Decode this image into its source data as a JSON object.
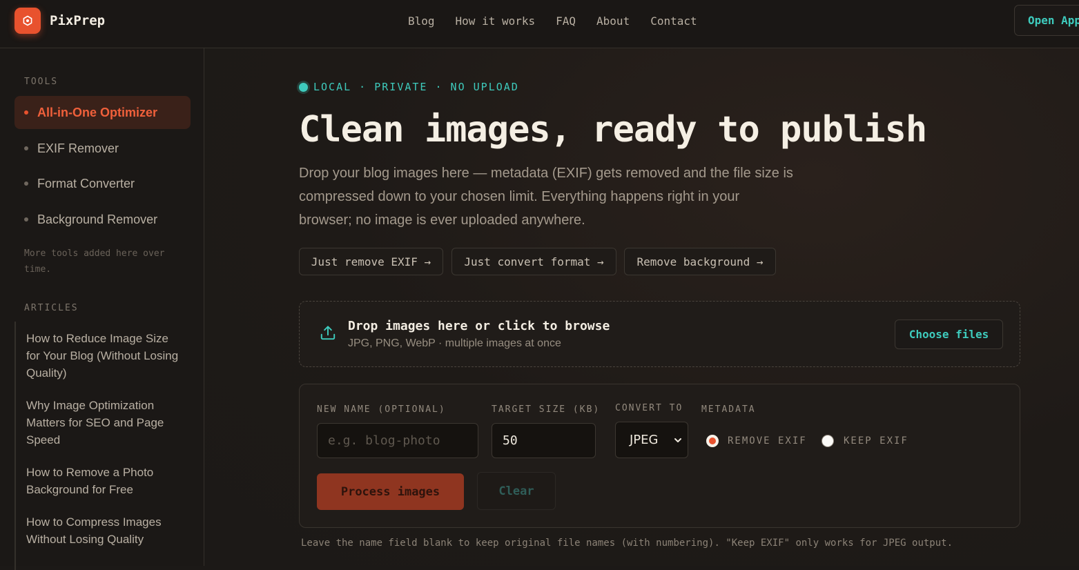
{
  "header": {
    "brand": "PixPrep",
    "nav": [
      "Blog",
      "How it works",
      "FAQ",
      "About",
      "Contact"
    ],
    "open_app": "Open App"
  },
  "sidebar": {
    "tools_heading": "TOOLS",
    "tools": [
      {
        "label": "All-in-One Optimizer",
        "active": true
      },
      {
        "label": "EXIF Remover",
        "active": false
      },
      {
        "label": "Format Converter",
        "active": false
      },
      {
        "label": "Background Remover",
        "active": false
      }
    ],
    "more_note": "More tools added here over time.",
    "articles_heading": "ARTICLES",
    "articles": [
      "How to Reduce Image Size for Your Blog (Without Losing Quality)",
      "Why Image Optimization Matters for SEO and Page Speed",
      "How to Remove a Photo Background for Free",
      "How to Compress Images Without Losing Quality"
    ]
  },
  "main": {
    "badge": "LOCAL · PRIVATE · NO UPLOAD",
    "headline": "Clean images, ready to publish",
    "lede": "Drop your blog images here — metadata (EXIF) gets removed and the file size is compressed down to your chosen limit. Everything happens right in your browser; no image is ever uploaded anywhere.",
    "quick_links": [
      "Just remove EXIF →",
      "Just convert format →",
      "Remove background →"
    ],
    "dropzone": {
      "title": "Drop images here or click to browse",
      "subtitle": "JPG, PNG, WebP · multiple images at once",
      "button": "Choose files"
    },
    "form": {
      "name_label": "NEW NAME (OPTIONAL)",
      "name_placeholder": "e.g. blog-photo",
      "name_value": "",
      "size_label": "TARGET SIZE (KB)",
      "size_value": "50",
      "convert_label": "CONVERT TO",
      "convert_value": "JPEG",
      "metadata_label": "METADATA",
      "metadata_options": [
        {
          "label": "REMOVE EXIF",
          "selected": true
        },
        {
          "label": "KEEP EXIF",
          "selected": false
        }
      ],
      "process_button": "Process images",
      "clear_button": "Clear"
    },
    "footnote": "Leave the name field blank to keep original file names (with numbering). \"Keep EXIF\" only works for JPEG output."
  },
  "colors": {
    "accent": "#e8522e",
    "teal": "#3ecbbd",
    "background": "#1c1917"
  },
  "icons": [
    "logo-icon",
    "upload-icon",
    "chevron-down-icon"
  ]
}
